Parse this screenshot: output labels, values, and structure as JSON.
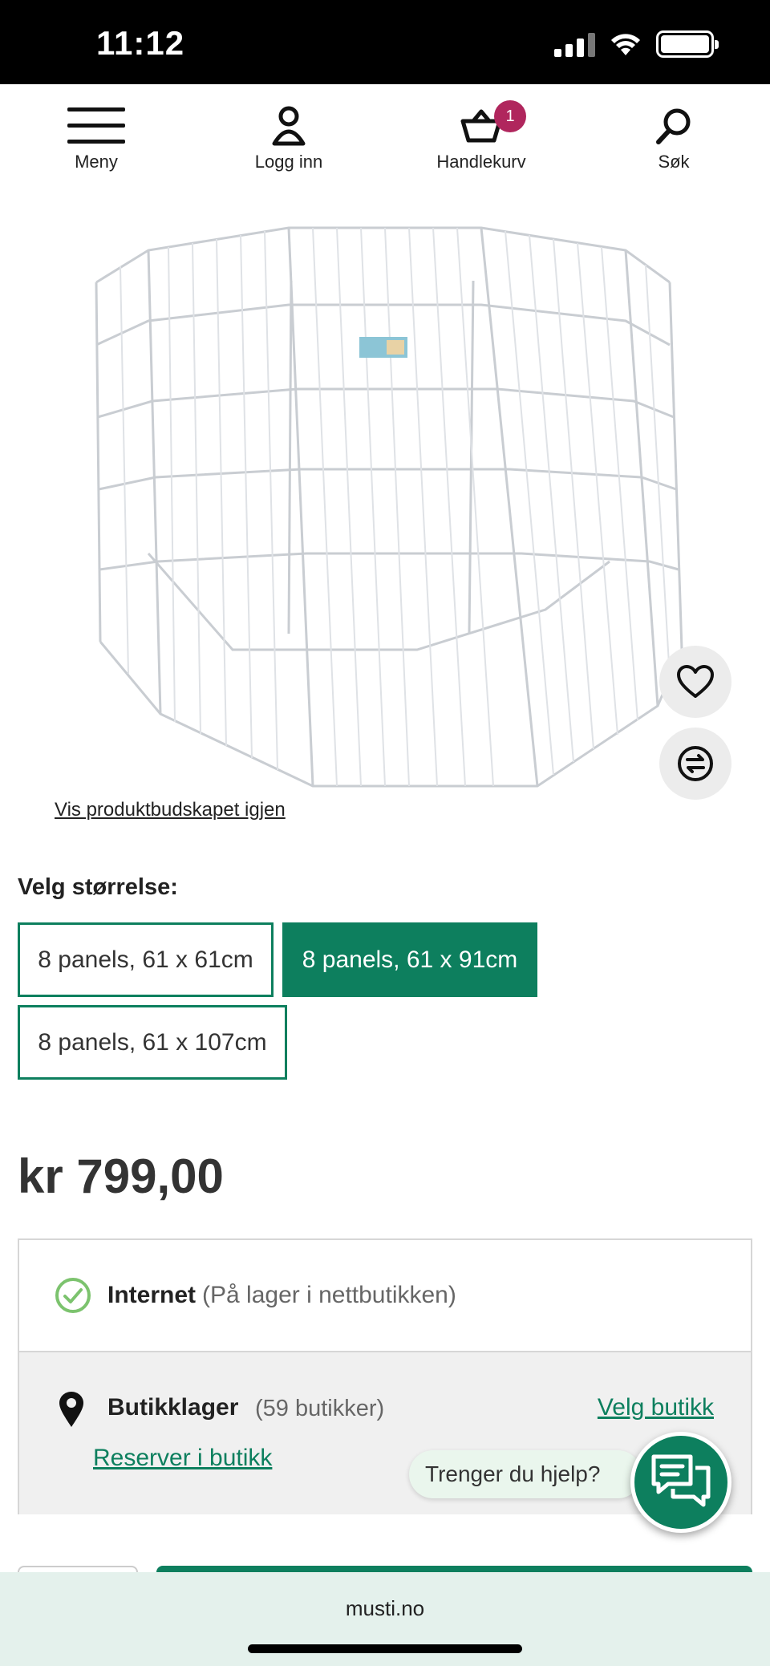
{
  "status_bar": {
    "time": "11:12"
  },
  "nav": {
    "menu_label": "Meny",
    "login_label": "Logg inn",
    "cart_label": "Handlekurv",
    "cart_count": "1",
    "search_label": "Søk"
  },
  "product": {
    "show_message_link": "Vis produktbudskapet igjen",
    "size_title": "Velg størrelse:",
    "sizes": [
      {
        "label": "8 panels, 61 x 61cm",
        "selected": false
      },
      {
        "label": "8 panels, 61 x 91cm",
        "selected": true
      },
      {
        "label": "8 panels, 61 x 107cm",
        "selected": false
      }
    ],
    "price": "kr 799,00"
  },
  "stock": {
    "internet_title": "Internet",
    "internet_status": "(På lager i nettbutikken)",
    "store_title": "Butikklager",
    "store_count": "(59 butikker)",
    "select_store_link": "Velg butikk",
    "reserve_link": "Reserver i butikk"
  },
  "help": {
    "bubble_text": "Trenger du hjelp?"
  },
  "browser": {
    "url": "musti.no"
  },
  "colors": {
    "brand_green": "#0d7f5e",
    "badge": "#b0265d",
    "check_green": "#7cc36e"
  }
}
